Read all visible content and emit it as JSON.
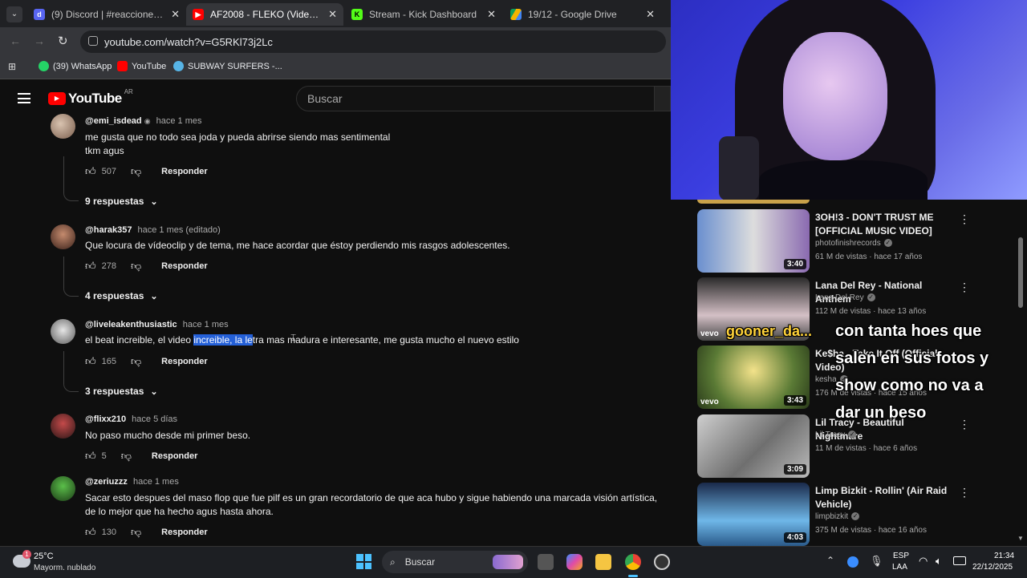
{
  "browser": {
    "tabs": [
      {
        "title": "(9) Discord | #reacciones-musi",
        "active": false
      },
      {
        "title": "AF2008 - FLEKO (Video Oficial)",
        "active": true
      },
      {
        "title": "Stream - Kick Dashboard",
        "active": false
      },
      {
        "title": "19/12 - Google Drive",
        "active": false
      }
    ],
    "url": "youtube.com/watch?v=G5RKl73j2Lc",
    "bookmarks": [
      "(39) WhatsApp",
      "YouTube",
      "SUBWAY SURFERS -..."
    ]
  },
  "youtube": {
    "logo": "YouTube",
    "region": "AR",
    "search_placeholder": "Buscar"
  },
  "comments": [
    {
      "user": "@emi_isdead",
      "time": "hace 1 mes",
      "text1": "me gusta que no todo sea joda y pueda abrirse siendo mas sentimental",
      "text2": "tkm agus",
      "likes": "507",
      "reply": "Responder",
      "replies": "9 respuestas"
    },
    {
      "user": "@harak357",
      "time": "hace 1 mes (editado)",
      "text1": "Que locura de vídeoclip y de tema, me hace acordar que éstoy perdiendo mis rasgos adolescentes.",
      "likes": "278",
      "reply": "Responder",
      "replies": "4 respuestas"
    },
    {
      "user": "@liveleakenthusiastic",
      "time": "hace 1 mes",
      "text_a": "el beat increible, el video ",
      "text_b": "increible, la le",
      "text_c": "tra mas madura e interesante, me gusta mucho el nuevo estilo",
      "likes": "165",
      "reply": "Responder",
      "replies": "3 respuestas"
    },
    {
      "user": "@flixx210",
      "time": "hace 5 días",
      "text1": "No paso mucho desde mi primer beso.",
      "likes": "5",
      "reply": "Responder"
    },
    {
      "user": "@zeriuzzz",
      "time": "hace 1 mes",
      "text1": "Sacar esto despues del maso flop que fue pilf es un gran recordatorio de que aca hubo y sigue habiendo una marcada visión artística, de lo mejor que ha hecho agus hasta ahora.",
      "likes": "130",
      "reply": "Responder"
    }
  ],
  "recommendations": [
    {
      "title": "3OH!3 - DON'T TRUST ME [OFFICIAL MUSIC VIDEO]",
      "channel": "photofinishrecords",
      "meta": "61 M de vistas · hace 17 años",
      "duration": "3:40"
    },
    {
      "title": "Lana Del Rey - National Anthem",
      "channel": "Lana Del Rey",
      "meta": "112 M de vistas · hace 13 años",
      "duration": ""
    },
    {
      "title": "Ke$ha - Take It Off (Official Video)",
      "channel": "kesha",
      "meta": "176 M de vistas · hace 15 años",
      "duration": "3:43"
    },
    {
      "title": "Lil Tracy - Beautiful Nightmare",
      "channel": "Lil Tracy",
      "meta": "11 M de vistas · hace 6 años",
      "duration": "3:09"
    },
    {
      "title": "Limp Bizkit - Rollin' (Air Raid Vehicle)",
      "channel": "limpbizkit",
      "meta": "375 M de vistas · hace 16 años",
      "duration": "4:03"
    }
  ],
  "overlay": {
    "name": "gooner_da...",
    "lines": [
      "con tanta hoes que",
      "salen en sus fotos y",
      "show como no va a",
      "dar un beso"
    ]
  },
  "taskbar": {
    "temp": "25°C",
    "weather": "Mayorm. nublado",
    "weather_badge": "1",
    "search": "Buscar",
    "lang1": "ESP",
    "lang2": "LAA",
    "time": "21:34",
    "date": "22/12/2025"
  },
  "colors": {
    "yt_red": "#ff0000",
    "highlight": "#2460d8",
    "taskbar": "#1d1f23"
  }
}
